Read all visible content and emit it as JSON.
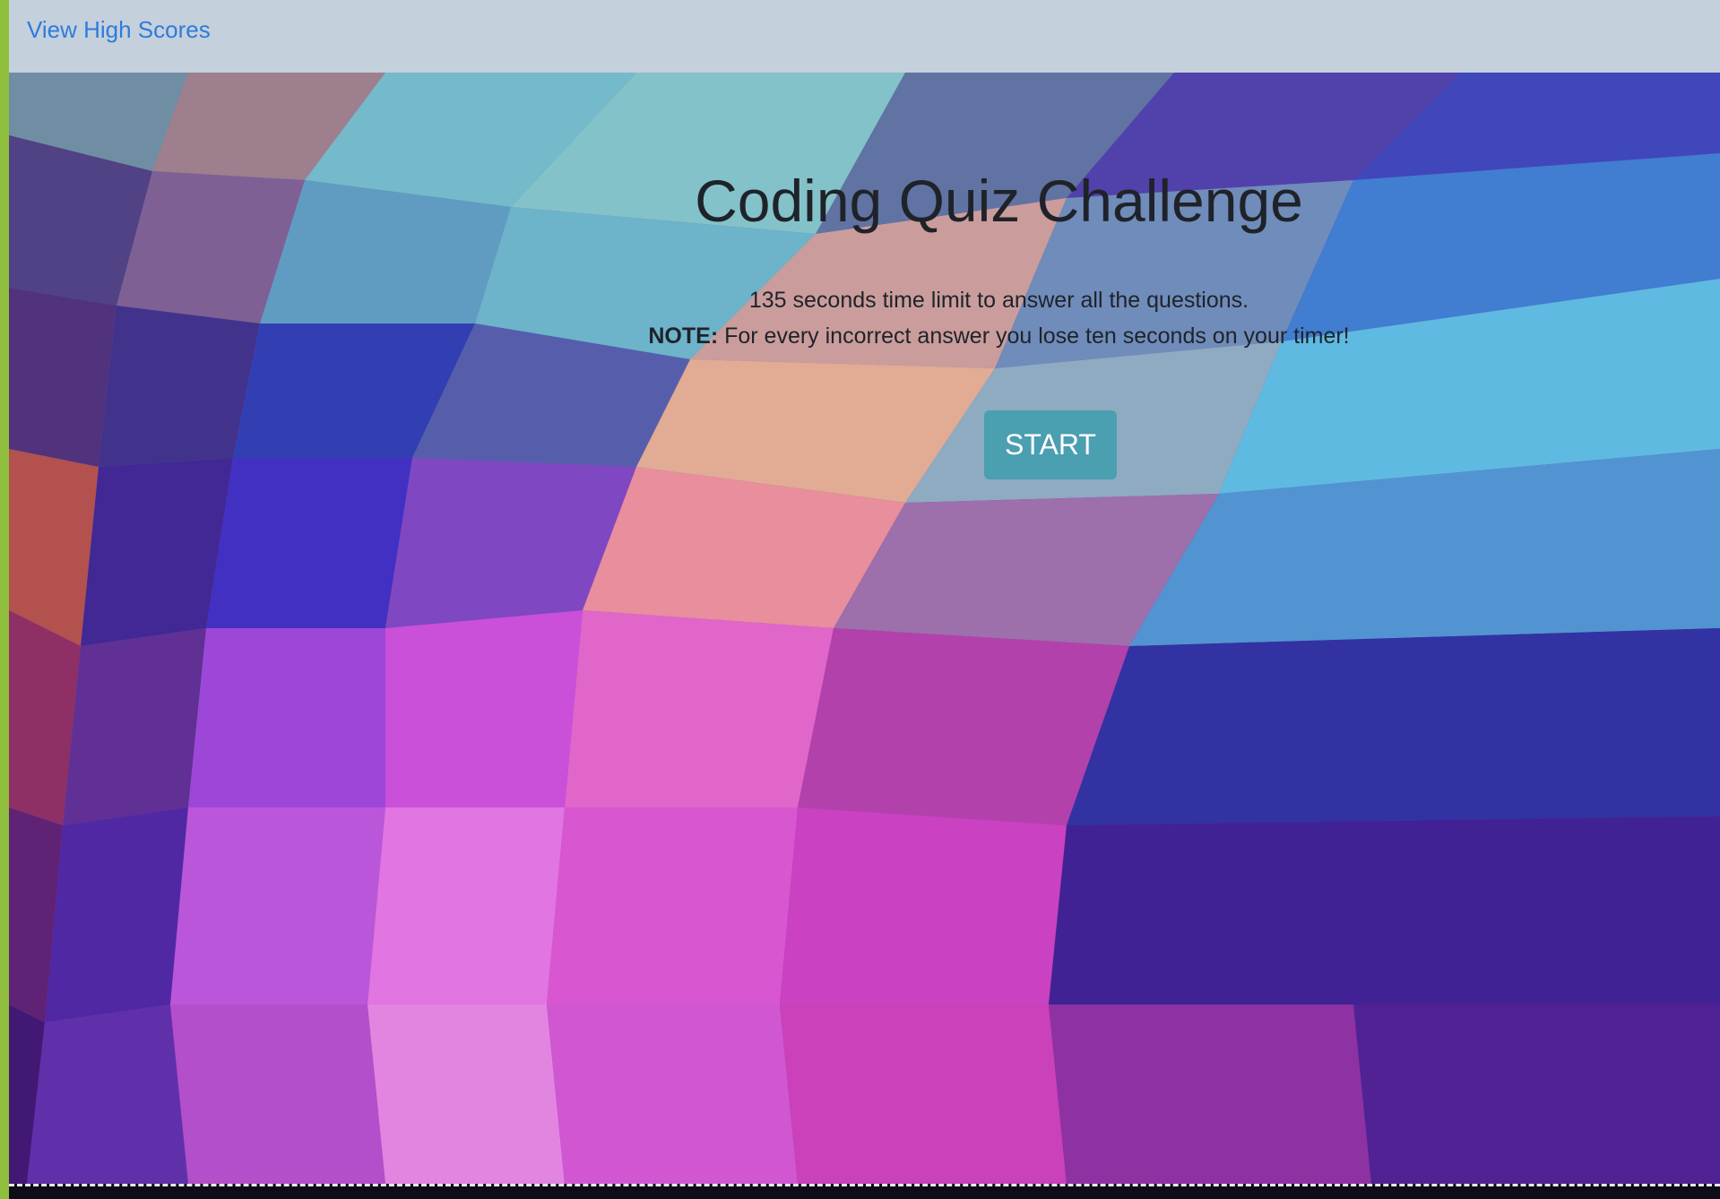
{
  "nav": {
    "high_scores_link": "View High Scores"
  },
  "hero": {
    "title": "Coding Quiz Challenge",
    "description_line1": "135 seconds time limit to answer all the questions.",
    "note_label": "NOTE:",
    "note_text": " For every incorrect answer you lose ten seconds on your timer!",
    "start_button": "START"
  },
  "colors": {
    "nav_bg": "#c4d0dc",
    "link": "#2f7bdc",
    "button": "#4a9fb0",
    "left_strip": "#8fbf3d"
  }
}
